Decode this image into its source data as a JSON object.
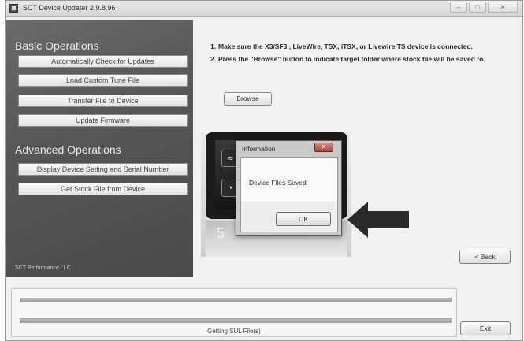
{
  "window": {
    "title": "SCT Device Updater 2.9.8.96",
    "controls": [
      "–",
      "□",
      "✕"
    ]
  },
  "left_panel": {
    "basic_title": "Basic Operations",
    "basic_buttons": [
      "Automatically Check for Updates",
      "Load Custom Tune File",
      "Transfer File to Device",
      "Update Firmware"
    ],
    "advanced_title": "Advanced Operations",
    "advanced_buttons": [
      "Display Device Setting and Serial Number",
      "Get Stock File from Device"
    ],
    "footer": "SCT Performance LLC"
  },
  "instructions": {
    "steps": [
      {
        "num": "1.",
        "text": "Make sure the X3/SF3 , LiveWire, TSX, iTSX, or Livewire TS device is connected."
      },
      {
        "num": "2.",
        "text": "Press the \"Browse\" button to indicate target folder where stock file will be saved to."
      }
    ],
    "browse_label": "Browse"
  },
  "device_image": {
    "reflection_glyphs": [
      "5",
      "+",
      "☆"
    ]
  },
  "dialog": {
    "title": "Information",
    "close_label": "✕",
    "message": "Device Files Saved",
    "ok_label": "OK"
  },
  "navigation": {
    "back_label": "< Back",
    "exit_label": "Exit"
  },
  "status": {
    "text": "Getting SUL File(s)",
    "progress_1": 1.0,
    "progress_2": 1.0
  },
  "colors": {
    "left_panel": "#575757",
    "arrow": "#2a2a2a",
    "dialog_close": "#b2453a"
  }
}
